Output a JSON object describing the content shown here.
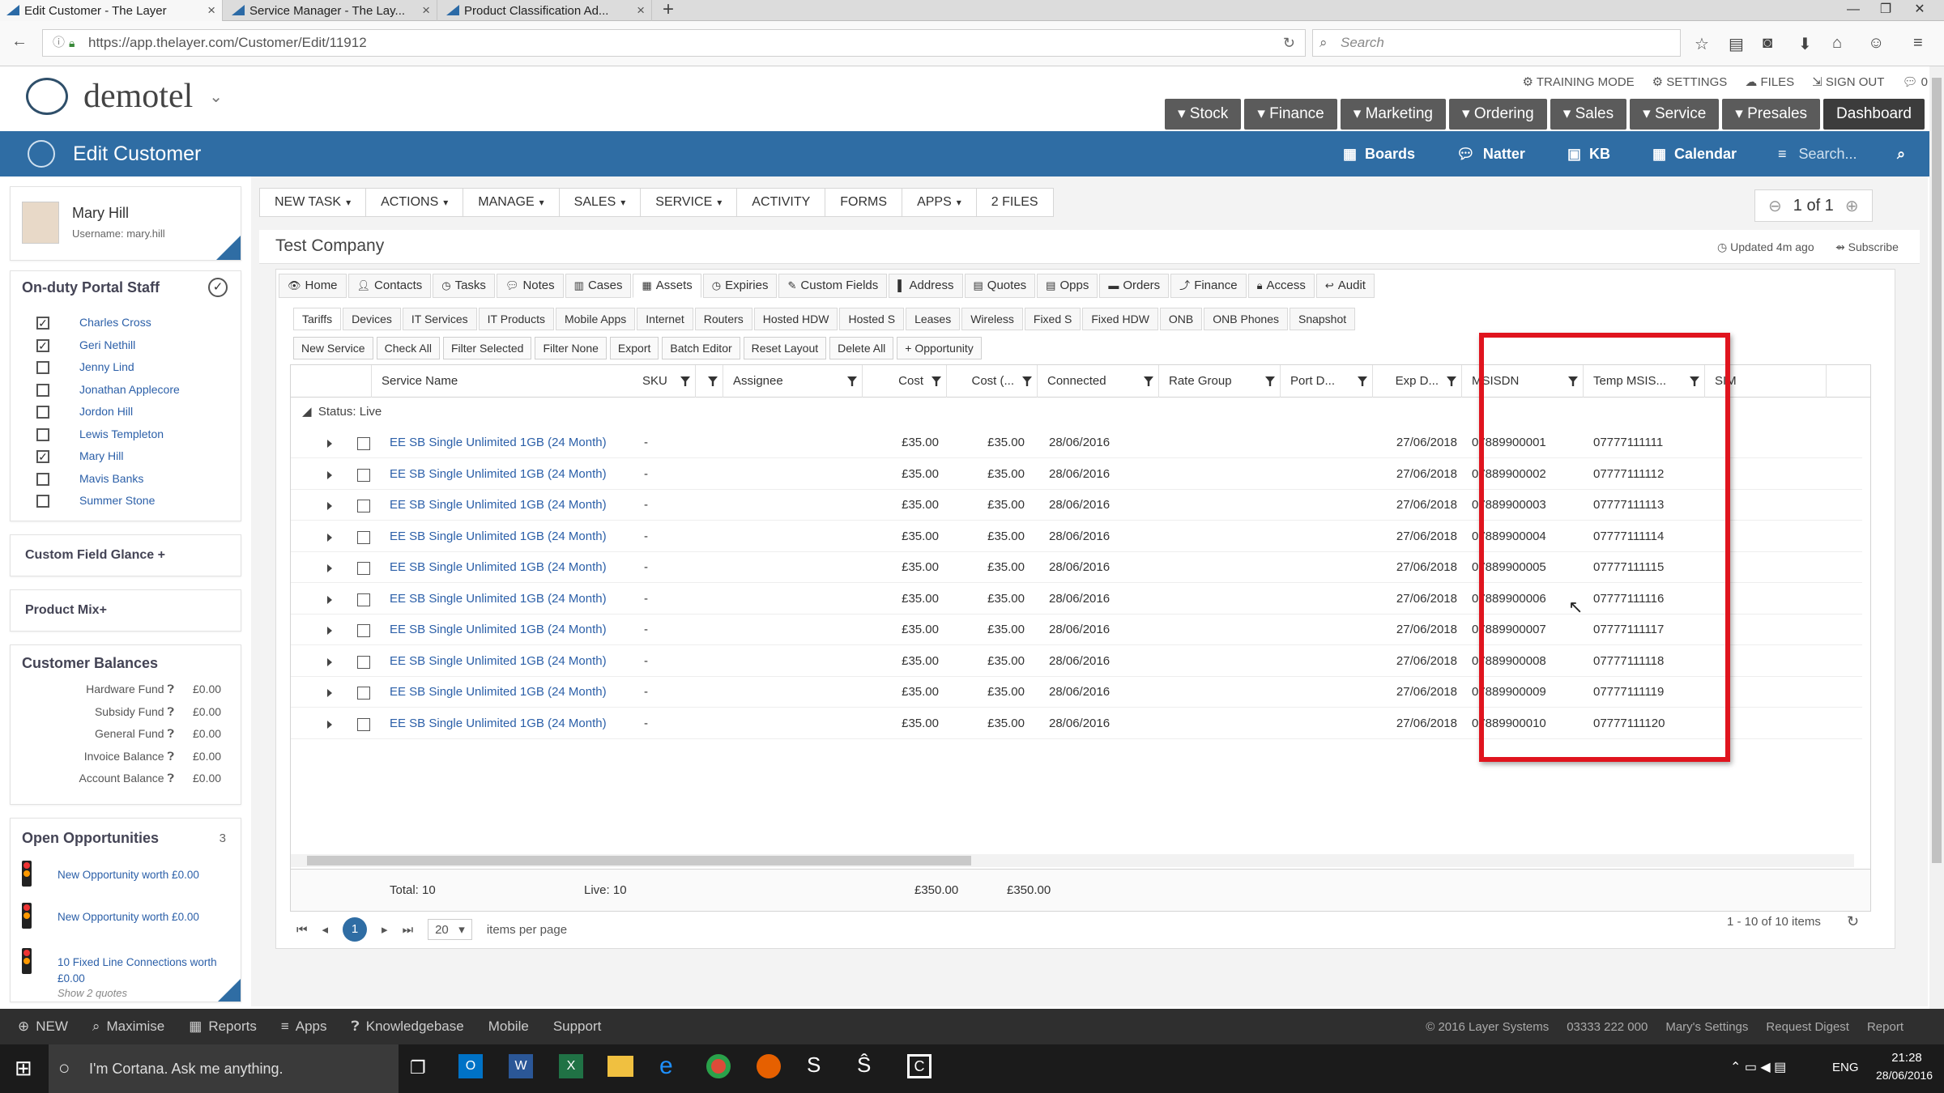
{
  "browser": {
    "tabs": [
      {
        "title": "Edit Customer - The Layer"
      },
      {
        "title": "Service Manager - The Lay..."
      },
      {
        "title": "Product Classification Ad..."
      }
    ],
    "url": "https://app.thelayer.com/Customer/Edit/11912",
    "search_placeholder": "Search"
  },
  "app": {
    "logo": "demotel",
    "top_links": [
      "TRAINING MODE",
      "SETTINGS",
      "FILES",
      "SIGN OUT",
      "0"
    ],
    "main_nav": [
      "Stock",
      "Finance",
      "Marketing",
      "Ordering",
      "Sales",
      "Service",
      "Presales",
      "Dashboard"
    ],
    "page_title": "Edit Customer",
    "bar_items": [
      "Boards",
      "Natter",
      "KB",
      "Calendar"
    ],
    "bar_search": "Search..."
  },
  "user": {
    "name": "Mary Hill",
    "username": "Username: mary.hill"
  },
  "staff": {
    "title": "On-duty Portal Staff",
    "members": [
      {
        "name": "Charles Cross",
        "checked": true
      },
      {
        "name": "Geri Nethill",
        "checked": true
      },
      {
        "name": "Jenny Lind",
        "checked": false
      },
      {
        "name": "Jonathan Applecore",
        "checked": false
      },
      {
        "name": "Jordon Hill",
        "checked": false
      },
      {
        "name": "Lewis Templeton",
        "checked": false
      },
      {
        "name": "Mary Hill",
        "checked": true
      },
      {
        "name": "Mavis Banks",
        "checked": false
      },
      {
        "name": "Summer Stone",
        "checked": false
      }
    ]
  },
  "sidebar": {
    "custom_field": "Custom Field Glance +",
    "product_mix": "Product Mix+",
    "balances_title": "Customer Balances",
    "balances": [
      {
        "label": "Hardware Fund",
        "value": "£0.00"
      },
      {
        "label": "Subsidy Fund",
        "value": "£0.00"
      },
      {
        "label": "General Fund",
        "value": "£0.00"
      },
      {
        "label": "Invoice Balance",
        "value": "£0.00"
      },
      {
        "label": "Account Balance",
        "value": "£0.00"
      }
    ],
    "opps_title": "Open Opportunities",
    "opps_count": "3",
    "opps": [
      "New Opportunity worth £0.00",
      "New Opportunity worth £0.00",
      "10 Fixed Line Connections worth £0.00"
    ],
    "show_quotes": "Show 2 quotes"
  },
  "toolbar": [
    "NEW TASK",
    "ACTIONS",
    "MANAGE",
    "SALES",
    "SERVICE",
    "ACTIVITY",
    "FORMS",
    "APPS",
    "2 FILES"
  ],
  "pager": "1 of 1",
  "company": "Test Company",
  "updated": "Updated 4m ago",
  "subscribe": "Subscribe",
  "tabs1": [
    "Home",
    "Contacts",
    "Tasks",
    "Notes",
    "Cases",
    "Assets",
    "Expiries",
    "Custom Fields",
    "Address",
    "Quotes",
    "Opps",
    "Orders",
    "Finance",
    "Access",
    "Audit"
  ],
  "tabs2": [
    "Tariffs",
    "Devices",
    "IT Services",
    "IT Products",
    "Mobile Apps",
    "Internet",
    "Routers",
    "Hosted HDW",
    "Hosted S",
    "Leases",
    "Wireless",
    "Fixed S",
    "Fixed HDW",
    "ONB",
    "ONB Phones",
    "Snapshot"
  ],
  "actions": [
    "New Service",
    "Check All",
    "Filter Selected",
    "Filter None",
    "Export",
    "Batch Editor",
    "Reset Layout",
    "Delete All",
    "+ Opportunity"
  ],
  "grid": {
    "columns": [
      "Service Name",
      "SKU",
      "Assignee",
      "Cost",
      "Cost (...",
      "Connected",
      "Rate Group",
      "Port D...",
      "Exp D...",
      "MSISDN",
      "Temp MSIS...",
      "SIM"
    ],
    "group": "Status: Live",
    "rows": [
      {
        "name": "EE SB Single Unlimited 1GB (24 Month)",
        "sku": "-",
        "cost": "£35.00",
        "cost2": "£35.00",
        "connected": "28/06/2016",
        "exp": "27/06/2018",
        "msisdn": "07889900001",
        "temp": "07777111111"
      },
      {
        "name": "EE SB Single Unlimited 1GB (24 Month)",
        "sku": "-",
        "cost": "£35.00",
        "cost2": "£35.00",
        "connected": "28/06/2016",
        "exp": "27/06/2018",
        "msisdn": "07889900002",
        "temp": "07777111112"
      },
      {
        "name": "EE SB Single Unlimited 1GB (24 Month)",
        "sku": "-",
        "cost": "£35.00",
        "cost2": "£35.00",
        "connected": "28/06/2016",
        "exp": "27/06/2018",
        "msisdn": "07889900003",
        "temp": "07777111113"
      },
      {
        "name": "EE SB Single Unlimited 1GB (24 Month)",
        "sku": "-",
        "cost": "£35.00",
        "cost2": "£35.00",
        "connected": "28/06/2016",
        "exp": "27/06/2018",
        "msisdn": "07889900004",
        "temp": "07777111114"
      },
      {
        "name": "EE SB Single Unlimited 1GB (24 Month)",
        "sku": "-",
        "cost": "£35.00",
        "cost2": "£35.00",
        "connected": "28/06/2016",
        "exp": "27/06/2018",
        "msisdn": "07889900005",
        "temp": "07777111115"
      },
      {
        "name": "EE SB Single Unlimited 1GB (24 Month)",
        "sku": "-",
        "cost": "£35.00",
        "cost2": "£35.00",
        "connected": "28/06/2016",
        "exp": "27/06/2018",
        "msisdn": "07889900006",
        "temp": "07777111116"
      },
      {
        "name": "EE SB Single Unlimited 1GB (24 Month)",
        "sku": "-",
        "cost": "£35.00",
        "cost2": "£35.00",
        "connected": "28/06/2016",
        "exp": "27/06/2018",
        "msisdn": "07889900007",
        "temp": "07777111117"
      },
      {
        "name": "EE SB Single Unlimited 1GB (24 Month)",
        "sku": "-",
        "cost": "£35.00",
        "cost2": "£35.00",
        "connected": "28/06/2016",
        "exp": "27/06/2018",
        "msisdn": "07889900008",
        "temp": "07777111118"
      },
      {
        "name": "EE SB Single Unlimited 1GB (24 Month)",
        "sku": "-",
        "cost": "£35.00",
        "cost2": "£35.00",
        "connected": "28/06/2016",
        "exp": "27/06/2018",
        "msisdn": "07889900009",
        "temp": "07777111119"
      },
      {
        "name": "EE SB Single Unlimited 1GB (24 Month)",
        "sku": "-",
        "cost": "£35.00",
        "cost2": "£35.00",
        "connected": "28/06/2016",
        "exp": "27/06/2018",
        "msisdn": "07889900010",
        "temp": "07777111120"
      }
    ],
    "total": "Total: 10",
    "live": "Live: 10",
    "sum_cost": "£350.00",
    "sum_cost2": "£350.00",
    "page": "1",
    "per_page_value": "20",
    "per_page_label": "items per page",
    "range": "1 - 10 of 10 items"
  },
  "footer": {
    "items": [
      "NEW",
      "Maximise",
      "Reports",
      "Apps",
      "Knowledgebase",
      "Mobile",
      "Support"
    ],
    "right": [
      "© 2016 Layer Systems",
      "03333 222 000",
      "Mary's Settings",
      "Request Digest",
      "Report"
    ]
  },
  "taskbar": {
    "cortana": "I'm Cortana. Ask me anything.",
    "lang": "ENG",
    "time": "21:28",
    "date": "28/06/2016"
  },
  "highlight_color": "#e0141e"
}
